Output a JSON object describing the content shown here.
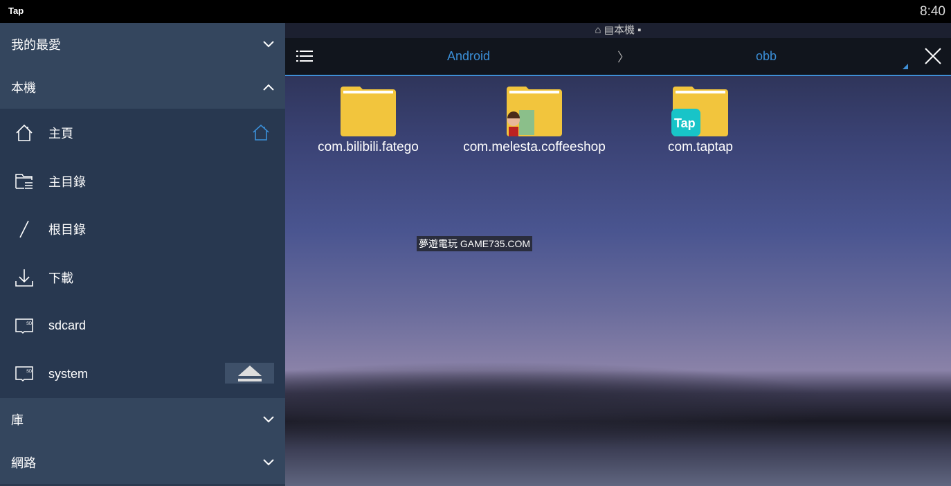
{
  "status_bar": {
    "app_name": "Tap",
    "time": "8:40"
  },
  "sidebar": {
    "sections": [
      {
        "label": "我的最愛",
        "state": "collapsed"
      },
      {
        "label": "本機",
        "state": "expanded"
      },
      {
        "label": "庫",
        "state": "collapsed"
      },
      {
        "label": "網路",
        "state": "collapsed"
      }
    ],
    "items": [
      {
        "label": "主頁",
        "icon": "home-icon"
      },
      {
        "label": "主目錄",
        "icon": "folder-list-icon"
      },
      {
        "label": "根目錄",
        "icon": "slash-icon"
      },
      {
        "label": "下載",
        "icon": "download-icon"
      },
      {
        "label": "sdcard",
        "icon": "sdcard-icon"
      },
      {
        "label": "system",
        "icon": "sdcard-icon"
      }
    ]
  },
  "location": {
    "label": "本機"
  },
  "toolbar": {
    "breadcrumbs": [
      "Android",
      "obb"
    ],
    "separator": "〉"
  },
  "folders": [
    {
      "name": "com.bilibili.fatego"
    },
    {
      "name": "com.melesta.coffeeshop"
    },
    {
      "name": "com.taptap",
      "badge": "Tap"
    }
  ],
  "watermark": "夢遊電玩 GAME735.COM",
  "colors": {
    "accent": "#3b8fd8",
    "folder": "#f2c53d",
    "sidebar": "#2b3a50"
  }
}
